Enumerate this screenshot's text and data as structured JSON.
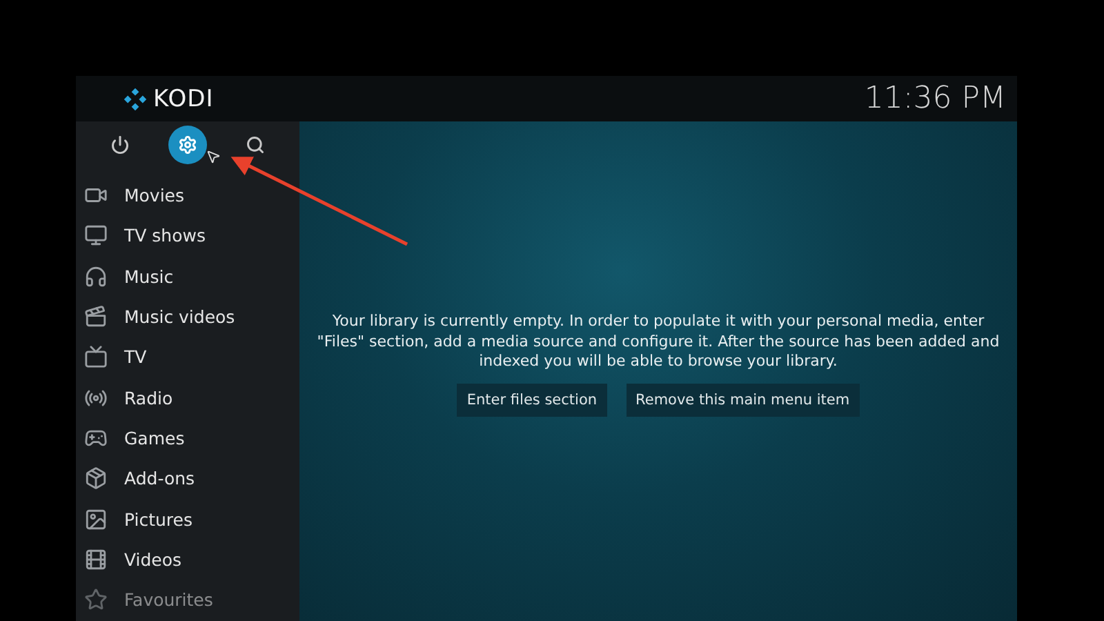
{
  "header": {
    "logo": "KODI",
    "clock": "11:36 PM"
  },
  "top_buttons": [
    {
      "kind": "power",
      "selected": false
    },
    {
      "kind": "settings",
      "selected": true
    },
    {
      "kind": "search",
      "selected": false
    }
  ],
  "menu": [
    {
      "kind": "movies",
      "label": "Movies"
    },
    {
      "kind": "tvshows",
      "label": "TV shows"
    },
    {
      "kind": "music",
      "label": "Music"
    },
    {
      "kind": "musicvideos",
      "label": "Music videos"
    },
    {
      "kind": "tv",
      "label": "TV"
    },
    {
      "kind": "radio",
      "label": "Radio"
    },
    {
      "kind": "games",
      "label": "Games"
    },
    {
      "kind": "addons",
      "label": "Add-ons"
    },
    {
      "kind": "pictures",
      "label": "Pictures"
    },
    {
      "kind": "videos",
      "label": "Videos"
    },
    {
      "kind": "favourites",
      "label": "Favourites"
    }
  ],
  "message": "Your library is currently empty. In order to populate it with your personal media, enter \"Files\" section, add a media source and configure it. After the source has been added and indexed you will be able to browse your library.",
  "buttons": [
    "Enter files section",
    "Remove this main menu item"
  ]
}
